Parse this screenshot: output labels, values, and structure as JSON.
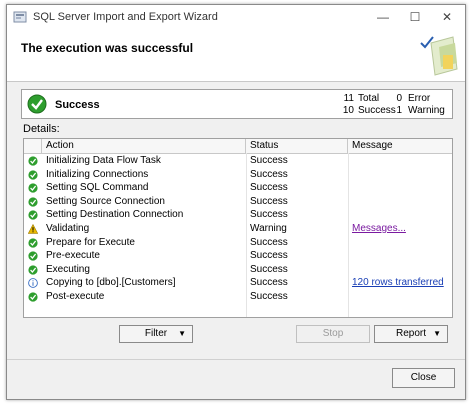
{
  "window": {
    "title": "SQL Server Import and Export Wizard"
  },
  "header": {
    "title": "The execution was successful"
  },
  "summary": {
    "status": "Success",
    "total_count": "11",
    "total_label": "Total",
    "success_count": "10",
    "success_label": "Success",
    "error_count": "0",
    "error_label": "Error",
    "warning_count": "1",
    "warning_label": "Warning"
  },
  "details_label": "Details:",
  "table": {
    "columns": [
      "Action",
      "Status",
      "Message"
    ],
    "rows": [
      {
        "icon": "success-icon",
        "action": "Initializing Data Flow Task",
        "status": "Success",
        "message": ""
      },
      {
        "icon": "success-icon",
        "action": "Initializing Connections",
        "status": "Success",
        "message": ""
      },
      {
        "icon": "success-icon",
        "action": "Setting SQL Command",
        "status": "Success",
        "message": ""
      },
      {
        "icon": "success-icon",
        "action": "Setting Source Connection",
        "status": "Success",
        "message": ""
      },
      {
        "icon": "success-icon",
        "action": "Setting Destination Connection",
        "status": "Success",
        "message": ""
      },
      {
        "icon": "warning-icon",
        "action": "Validating",
        "status": "Warning",
        "message": "Messages..."
      },
      {
        "icon": "success-icon",
        "action": "Prepare for Execute",
        "status": "Success",
        "message": ""
      },
      {
        "icon": "success-icon",
        "action": "Pre-execute",
        "status": "Success",
        "message": ""
      },
      {
        "icon": "success-icon",
        "action": "Executing",
        "status": "Success",
        "message": ""
      },
      {
        "icon": "info-icon",
        "action": "Copying to [dbo].[Customers]",
        "status": "Success",
        "message": "120 rows transferred"
      },
      {
        "icon": "success-icon",
        "action": "Post-execute",
        "status": "Success",
        "message": ""
      }
    ]
  },
  "buttons": {
    "filter": "Filter",
    "stop": "Stop",
    "report": "Report",
    "close": "Close"
  },
  "colors": {
    "success": "#2e9e2e",
    "warning": "#e8b800",
    "info": "#3a6fc4",
    "link": "#1a3fb5",
    "visited_link": "#7a1aa0"
  }
}
